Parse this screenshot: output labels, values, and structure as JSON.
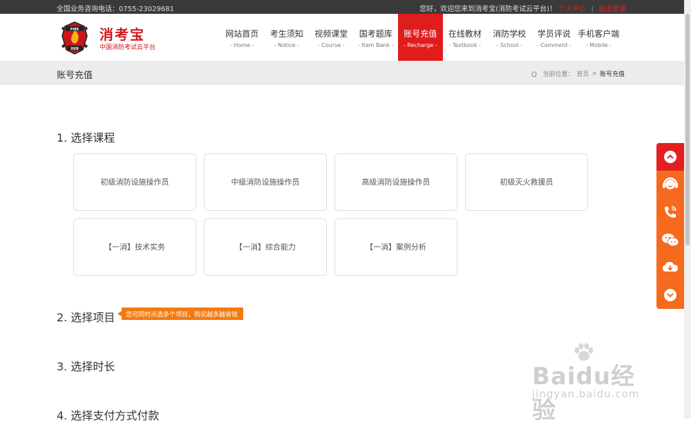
{
  "topbar": {
    "hotline": "全国业务咨询电话：0755-23029681",
    "welcome": "您好，欢迎您来到消考宝(消防考试云平台)！",
    "link1": "个人中心",
    "separator": "|",
    "link2": "退出登录"
  },
  "logo": {
    "brand": "消考宝",
    "subtitle": "中国消防考试云平台",
    "emblem_text_top": "FIRE",
    "emblem_text_bottom": "XKB"
  },
  "nav": [
    {
      "cn": "网站首页",
      "en": "- Home -"
    },
    {
      "cn": "考生须知",
      "en": "- Notice -"
    },
    {
      "cn": "视频课堂",
      "en": "- Course -"
    },
    {
      "cn": "国考题库",
      "en": "- Item Bank -"
    },
    {
      "cn": "账号充值",
      "en": "- Recharge -"
    },
    {
      "cn": "在线教材",
      "en": "- Textbook -"
    },
    {
      "cn": "消防学校",
      "en": "- School -"
    },
    {
      "cn": "学员评说",
      "en": "- Comment -"
    },
    {
      "cn": "手机客户端",
      "en": "- Mobile -"
    }
  ],
  "active_nav": "账号充值",
  "page_header": {
    "title": "账号充值",
    "crumb_prefix": "当前位置：",
    "crumb_home": "首页",
    "crumb_sep": ">",
    "crumb_current": "账号充值"
  },
  "steps": {
    "step1": "1. 选择课程",
    "step2": "2. 选择项目",
    "step3": "3. 选择时长",
    "step4": "4. 选择支付方式付款",
    "tip": "您可同时点选多个项目，购买越多越省钱"
  },
  "courses": [
    "初级消防设施操作员",
    "中级消防设施操作员",
    "高级消防设施操作员",
    "初级灭火救援员",
    "【一消】技术实务",
    "【一消】综合能力",
    "【一消】案例分析"
  ],
  "sidebar_icons": [
    "arrow-up-icon",
    "customer-service-icon",
    "phone-icon",
    "wechat-icon",
    "download-icon",
    "arrow-down-icon"
  ],
  "watermark": {
    "line1": "Baidu经验",
    "line2": "jingyan.baidu.com"
  },
  "colors": {
    "brand_red": "#e01d1d",
    "sidebar_orange": "#f56a1e",
    "tip_orange": "#f47a0f"
  }
}
